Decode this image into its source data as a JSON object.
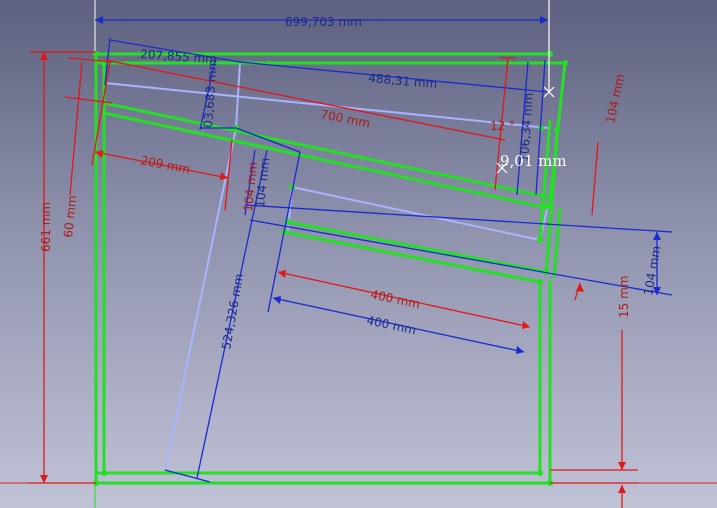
{
  "sketch": {
    "dimensions": {
      "total_width": "699,703 mm",
      "top_offset": "207,855 mm",
      "upper_length": "488,31 mm",
      "diagonal_700": "700 mm",
      "partial_3683": "03,683 mm",
      "offset_10634": "106,34 mm",
      "angle": "12 °",
      "height_104_right": "104 mm",
      "height_661": "661 mm",
      "height_60": "60 mm",
      "width_209": "209 mm",
      "height_104_center_red": "104 mm",
      "height_104_center_blue": "104 mm",
      "length_524326": "524,326 mm",
      "length_400_red": "400 mm",
      "length_400_blue": "400 mm",
      "height_15": "15 mm",
      "height_104_lower_right": "104 mm",
      "cursor_value": "9,01 mm"
    },
    "colors": {
      "geometry": "#22e022",
      "dimension_blue": "#1a2ad0",
      "dimension_red": "#e01818",
      "construction": "#a8b4ff"
    }
  }
}
